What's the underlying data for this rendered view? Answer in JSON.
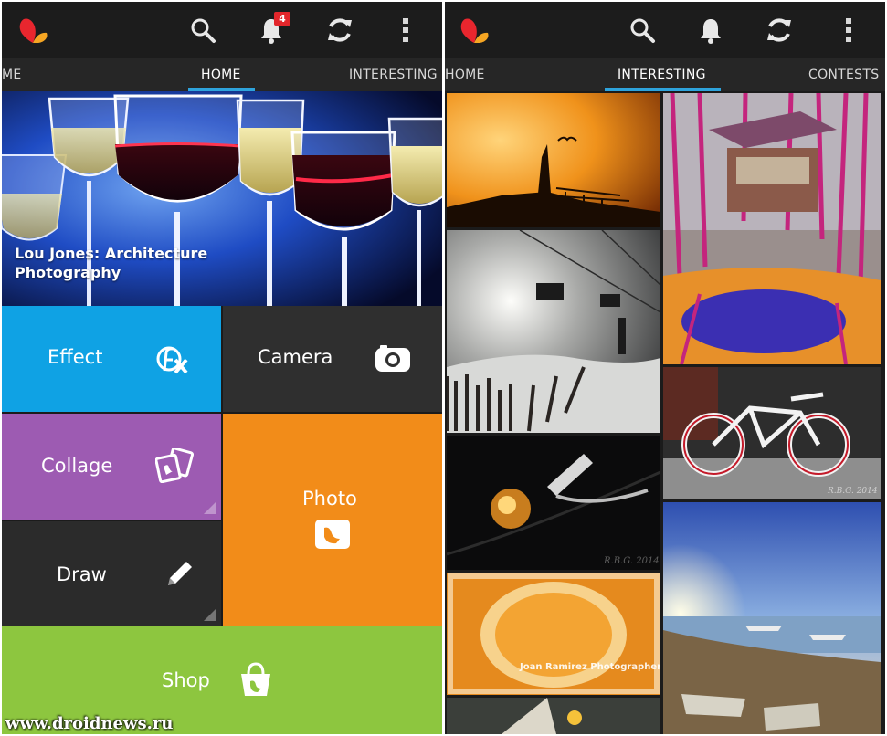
{
  "left": {
    "notification_count": "4",
    "tabs": [
      "ME",
      "HOME",
      "INTERESTING"
    ],
    "active_tab": "HOME",
    "featured_title": "Lou Jones: Architecture Photography",
    "tiles": {
      "effect": "Effect",
      "camera": "Camera",
      "collage": "Collage",
      "photo": "Photo",
      "draw": "Draw",
      "shop": "Shop"
    },
    "watermark": "www.droidnews.ru"
  },
  "right": {
    "tabs": [
      "HOME",
      "INTERESTING",
      "CONTESTS"
    ],
    "active_tab": "INTERESTING",
    "photo_captions": {
      "orange_cup": "Joan Ramirez Photographer",
      "bike_signature": "R.B.G. 2014",
      "bell_signature": "R.B.G. 2014"
    }
  },
  "colors": {
    "tab_indicator": "#2ea3dc",
    "effect": "#0fa2e4",
    "camera": "#2f2f2f",
    "collage": "#9d5bb2",
    "photo": "#f28c19",
    "draw": "#2b2b2b",
    "shop": "#8dc63f",
    "badge": "#e3262b"
  },
  "icons": [
    "app-logo-icon",
    "search-icon",
    "bell-icon",
    "refresh-icon",
    "overflow-menu-icon",
    "effect-fx-icon",
    "camera-icon",
    "collage-icon",
    "photo-icon",
    "pencil-icon",
    "shop-bag-icon"
  ]
}
